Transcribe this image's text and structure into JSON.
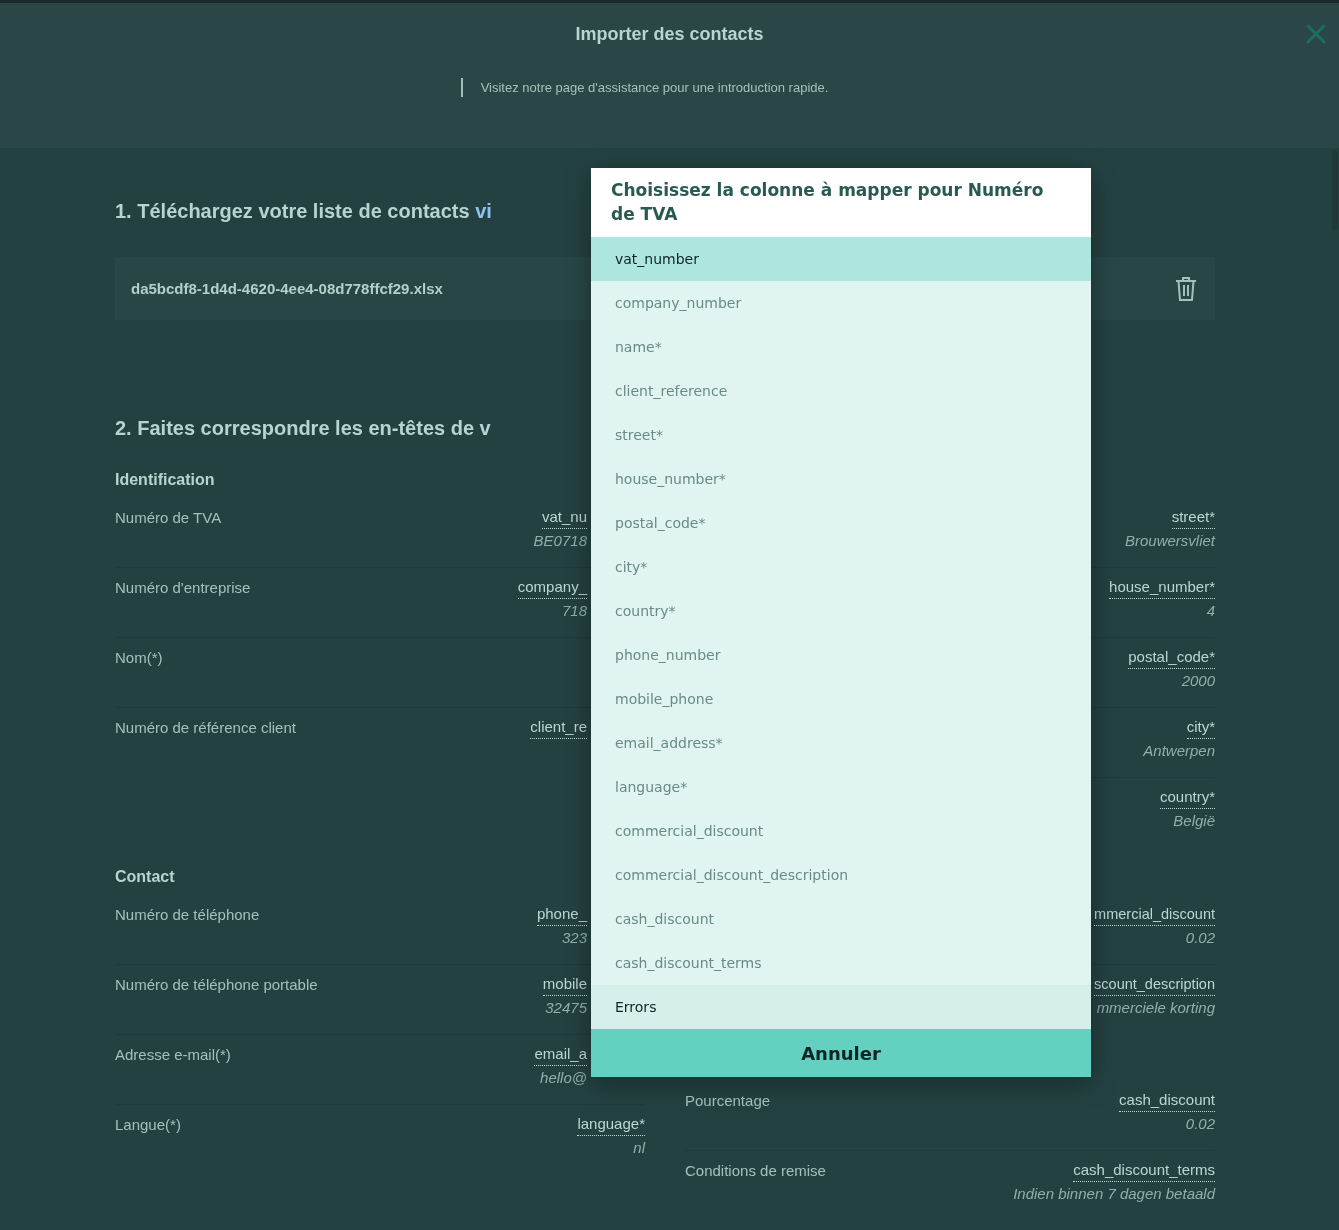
{
  "header": {
    "title": "Importer des contacts",
    "help_text": "Visitez notre page d'assistance pour une introduction rapide."
  },
  "upload": {
    "heading": "1. Téléchargez votre liste de contacts ",
    "heading_link": "vi",
    "file_name": "da5bcdf8-1d4d-4620-4ee4-08d778ffcf29.xlsx"
  },
  "mapping": {
    "heading": "2. Faites correspondre les en-têtes de v",
    "sections": [
      {
        "title": "Identification",
        "left_rows": [
          {
            "label": "Numéro de TVA",
            "column": "vat_nu",
            "sample": "BE0718"
          },
          {
            "label": "Numéro d'entreprise",
            "column": "company_",
            "sample": "718"
          },
          {
            "label": "Nom(*)"
          },
          {
            "label": "Numéro de référence client",
            "column": "client_re"
          }
        ],
        "right_rows": [
          {
            "column": "street*",
            "sample": "Brouwersvliet"
          },
          {
            "column": "house_number*",
            "sample": "4"
          },
          {
            "column": "postal_code*",
            "sample": "2000"
          },
          {
            "column": "city*",
            "sample": "Antwerpen"
          },
          {
            "column": "country*",
            "sample": "België"
          }
        ]
      },
      {
        "title": "Contact",
        "left_rows": [
          {
            "label": "Numéro de téléphone",
            "column": "phone_",
            "sample": "323"
          },
          {
            "label": "Numéro de téléphone portable",
            "column": "mobile",
            "sample": "32475"
          },
          {
            "label": "Adresse e-mail(*)",
            "column": "email_a",
            "sample": "hello@"
          },
          {
            "label": "Langue(*)",
            "column": "language*",
            "sample": "nl"
          }
        ],
        "right_rows": [
          {
            "column": "mmercial_discount",
            "sample": "0.02"
          },
          {
            "column": "scount_description",
            "sample": "mmerciele korting"
          },
          {
            "kind": "gap"
          },
          {
            "label": "Pourcentage",
            "column": "cash_discount",
            "sample": "0.02"
          },
          {
            "label": "Conditions de remise",
            "column": "cash_discount_terms",
            "sample": "Indien binnen 7 dagen betaald"
          }
        ]
      }
    ]
  },
  "dialog": {
    "title": "Choisissez la colonne à mapper pour Numéro de TVA",
    "options": [
      {
        "label": "vat_number",
        "kind": "column",
        "selected": true,
        "disabled": false
      },
      {
        "label": "company_number",
        "kind": "column",
        "selected": false,
        "disabled": true
      },
      {
        "label": "name*",
        "kind": "column",
        "selected": false,
        "disabled": true
      },
      {
        "label": "client_reference",
        "kind": "column",
        "selected": false,
        "disabled": true
      },
      {
        "label": "street*",
        "kind": "column",
        "selected": false,
        "disabled": true
      },
      {
        "label": "house_number*",
        "kind": "column",
        "selected": false,
        "disabled": true
      },
      {
        "label": "postal_code*",
        "kind": "column",
        "selected": false,
        "disabled": true
      },
      {
        "label": "city*",
        "kind": "column",
        "selected": false,
        "disabled": true
      },
      {
        "label": "country*",
        "kind": "column",
        "selected": false,
        "disabled": true
      },
      {
        "label": "phone_number",
        "kind": "column",
        "selected": false,
        "disabled": true
      },
      {
        "label": "mobile_phone",
        "kind": "column",
        "selected": false,
        "disabled": true
      },
      {
        "label": "email_address*",
        "kind": "column",
        "selected": false,
        "disabled": true
      },
      {
        "label": "language*",
        "kind": "column",
        "selected": false,
        "disabled": true
      },
      {
        "label": "commercial_discount",
        "kind": "column",
        "selected": false,
        "disabled": true
      },
      {
        "label": "commercial_discount_description",
        "kind": "column",
        "selected": false,
        "disabled": true
      },
      {
        "label": "cash_discount",
        "kind": "column",
        "selected": false,
        "disabled": true
      },
      {
        "label": "cash_discount_terms",
        "kind": "column",
        "selected": false,
        "disabled": true
      },
      {
        "label": "Errors",
        "kind": "errors",
        "selected": false,
        "disabled": false
      }
    ],
    "cancel_button": "Annuler"
  }
}
